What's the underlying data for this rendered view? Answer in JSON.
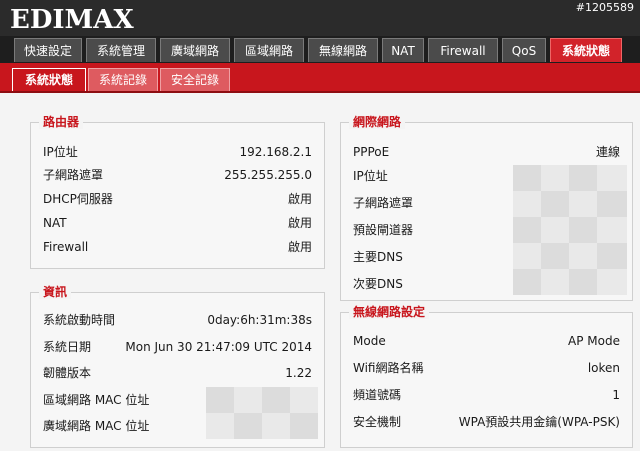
{
  "header": {
    "logo": "EDIMAX",
    "watermark": "#1205589"
  },
  "nav": {
    "tabs": [
      {
        "label": "快速設定"
      },
      {
        "label": "系統管理"
      },
      {
        "label": "廣域網路"
      },
      {
        "label": "區域網路"
      },
      {
        "label": "無線網路"
      },
      {
        "label": "NAT"
      },
      {
        "label": "Firewall"
      },
      {
        "label": "QoS"
      },
      {
        "label": "系統狀態"
      }
    ],
    "active": "系統狀態"
  },
  "subnav": {
    "tabs": [
      {
        "label": "系統狀態"
      },
      {
        "label": "系統記錄"
      },
      {
        "label": "安全記錄"
      }
    ]
  },
  "router": {
    "title": "路由器",
    "rows": [
      {
        "label": "IP位址",
        "value": "192.168.2.1"
      },
      {
        "label": "子網路遮罩",
        "value": "255.255.255.0"
      },
      {
        "label": "DHCP伺服器",
        "value": "啟用"
      },
      {
        "label": "NAT",
        "value": "啟用"
      },
      {
        "label": "Firewall",
        "value": "啟用"
      }
    ]
  },
  "info": {
    "title": "資訊",
    "rows": [
      {
        "label": "系統啟動時間",
        "value": "0day:6h:31m:38s"
      },
      {
        "label": "系統日期",
        "value": "Mon Jun 30 21:47:09 UTC 2014"
      },
      {
        "label": "韌體版本",
        "value": "1.22"
      },
      {
        "label": "區域網路 MAC 位址",
        "value": ""
      },
      {
        "label": "廣域網路 MAC 位址",
        "value": ""
      }
    ]
  },
  "internet": {
    "title": "網際網路",
    "rows": [
      {
        "label": "PPPoE",
        "value": "連線"
      },
      {
        "label": "IP位址",
        "value": ""
      },
      {
        "label": "子網路遮罩",
        "value": ""
      },
      {
        "label": "預設閘道器",
        "value": ""
      },
      {
        "label": "主要DNS",
        "value": ""
      },
      {
        "label": "次要DNS",
        "value": ""
      }
    ]
  },
  "wireless": {
    "title": "無線網路設定",
    "rows": [
      {
        "label": "Mode",
        "value": "AP Mode"
      },
      {
        "label": "Wifi網路名稱",
        "value": "loken"
      },
      {
        "label": "頻道號碼",
        "value": "1"
      },
      {
        "label": "安全機制",
        "value": "WPA預設共用金鑰(WPA-PSK)"
      }
    ]
  },
  "colors": {
    "accent": "#c8161d",
    "topbar": "#2b2b2b",
    "tab": "#4b4b4b"
  }
}
